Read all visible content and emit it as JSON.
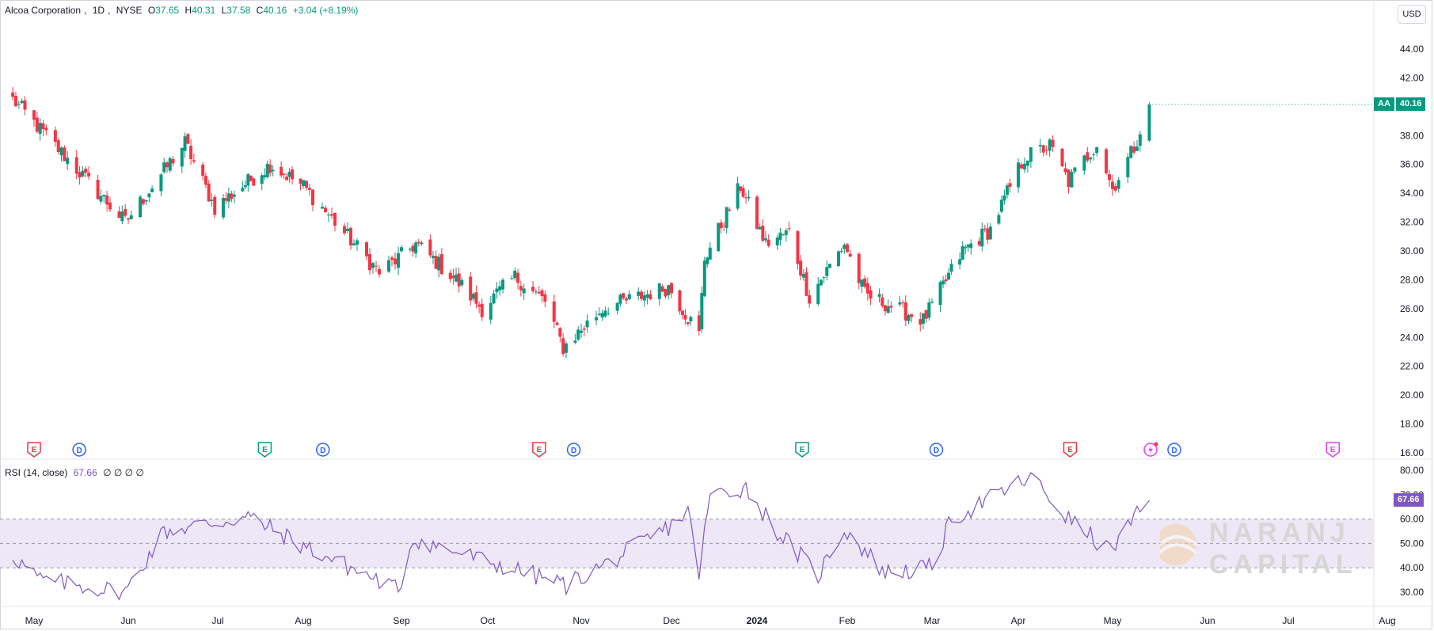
{
  "header": {
    "symbol_name": "Alcoa Corporation",
    "interval": "1D",
    "exchange": "NYSE",
    "open_label": "O",
    "open": "37.65",
    "high_label": "H",
    "high": "40.31",
    "low_label": "L",
    "low": "37.58",
    "close_label": "C",
    "close": "40.16",
    "change": "+3.04 (+8.19%)"
  },
  "currency": "USD",
  "last_price_tag": {
    "symbol": "AA",
    "value": "40.16"
  },
  "rsi": {
    "label": "RSI (14, close)",
    "value": "67.66",
    "extra": "∅ ∅ ∅ ∅"
  },
  "watermark": {
    "line1": "NARANJ",
    "line2": "CAPITAL"
  },
  "colors": {
    "up": "#089981",
    "down": "#f23645",
    "rsi": "#7e57c2",
    "rsi_band": "#ede7f6",
    "dividend": "#2962ff",
    "earnings_green": "#089981",
    "earnings_red": "#f23645",
    "earnings_purple": "#e040fb"
  },
  "chart_data": {
    "type": "candlestick",
    "price_axis": {
      "ticks": [
        "44.00",
        "42.00",
        "40.00",
        "38.00",
        "36.00",
        "34.00",
        "32.00",
        "30.00",
        "28.00",
        "26.00",
        "24.00",
        "22.00",
        "20.00",
        "18.00",
        "16.00"
      ],
      "ylim": [
        16,
        44
      ]
    },
    "time_axis": {
      "ticks": [
        "May",
        "Jun",
        "Jul",
        "Aug",
        "Sep",
        "Oct",
        "Nov",
        "Dec",
        "2024",
        "Feb",
        "Mar",
        "Apr",
        "May",
        "Jun",
        "Jul",
        "Aug"
      ]
    },
    "rsi_axis": {
      "ticks": [
        "80.00",
        "70.00",
        "60.00",
        "50.00",
        "40.00",
        "30.00"
      ],
      "band": [
        40,
        60
      ],
      "ylim": [
        25,
        82
      ]
    },
    "events": [
      {
        "type": "E",
        "style": "red",
        "month_pos": 0.0
      },
      {
        "type": "D",
        "style": "blue",
        "month_pos": 0.48
      },
      {
        "type": "E",
        "style": "green",
        "month_pos": 2.55
      },
      {
        "type": "D",
        "style": "blue",
        "month_pos": 3.2
      },
      {
        "type": "E",
        "style": "red",
        "month_pos": 5.55
      },
      {
        "type": "D",
        "style": "blue",
        "month_pos": 5.92
      },
      {
        "type": "E",
        "style": "green",
        "month_pos": 8.5
      },
      {
        "type": "D",
        "style": "blue",
        "month_pos": 10.05
      },
      {
        "type": "E",
        "style": "red",
        "month_pos": 11.55
      },
      {
        "type": "split",
        "style": "purple",
        "month_pos": 12.4
      },
      {
        "type": "D",
        "style": "blue",
        "month_pos": 12.65
      },
      {
        "type": "E",
        "style": "purple",
        "month_pos": 14.45
      }
    ],
    "key_points": [
      {
        "date": "2023-04-24",
        "close": 40.5
      },
      {
        "date": "2023-05-31",
        "close": 32.0
      },
      {
        "date": "2023-06-20",
        "close": 37.5
      },
      {
        "date": "2023-06-30",
        "close": 33.0
      },
      {
        "date": "2023-07-20",
        "close": 36.0
      },
      {
        "date": "2023-08-01",
        "close": 34.5
      },
      {
        "date": "2023-08-25",
        "close": 28.5
      },
      {
        "date": "2023-09-06",
        "close": 30.5
      },
      {
        "date": "2023-09-20",
        "close": 28.0
      },
      {
        "date": "2023-09-29",
        "close": 26.0
      },
      {
        "date": "2023-10-10",
        "close": 28.2
      },
      {
        "date": "2023-10-20",
        "close": 26.5
      },
      {
        "date": "2023-10-26",
        "close": 23.3
      },
      {
        "date": "2023-11-08",
        "close": 26.0
      },
      {
        "date": "2023-11-30",
        "close": 27.5
      },
      {
        "date": "2023-12-11",
        "close": 24.2
      },
      {
        "date": "2023-12-13",
        "close": 29.5
      },
      {
        "date": "2023-12-26",
        "close": 34.5
      },
      {
        "date": "2024-01-04",
        "close": 30.5
      },
      {
        "date": "2024-01-12",
        "close": 31.3
      },
      {
        "date": "2024-01-19",
        "close": 26.8
      },
      {
        "date": "2024-01-31",
        "close": 30.5
      },
      {
        "date": "2024-02-07",
        "close": 27.0
      },
      {
        "date": "2024-02-27",
        "close": 25.2
      },
      {
        "date": "2024-03-12",
        "close": 30.0
      },
      {
        "date": "2024-03-22",
        "close": 31.5
      },
      {
        "date": "2024-04-03",
        "close": 36.5
      },
      {
        "date": "2024-04-11",
        "close": 37.3
      },
      {
        "date": "2024-04-17",
        "close": 34.8
      },
      {
        "date": "2024-04-26",
        "close": 37.5
      },
      {
        "date": "2024-05-01",
        "close": 34.3
      },
      {
        "date": "2024-05-08",
        "close": 37.2
      },
      {
        "date": "2024-05-13",
        "close": 40.16
      }
    ],
    "rsi_key_points": [
      {
        "date": "2023-04-24",
        "rsi": 45
      },
      {
        "date": "2023-05-03",
        "rsi": 35
      },
      {
        "date": "2023-05-31",
        "rsi": 30
      },
      {
        "date": "2023-06-13",
        "rsi": 55
      },
      {
        "date": "2023-07-12",
        "rsi": 61
      },
      {
        "date": "2023-08-31",
        "rsi": 31
      },
      {
        "date": "2023-09-05",
        "rsi": 52
      },
      {
        "date": "2023-10-27",
        "rsi": 33
      },
      {
        "date": "2023-11-10",
        "rsi": 42
      },
      {
        "date": "2023-11-28",
        "rsi": 55
      },
      {
        "date": "2023-12-07",
        "rsi": 63
      },
      {
        "date": "2023-12-11",
        "rsi": 38
      },
      {
        "date": "2023-12-15",
        "rsi": 70
      },
      {
        "date": "2023-12-28",
        "rsi": 73
      },
      {
        "date": "2024-01-08",
        "rsi": 55
      },
      {
        "date": "2024-01-22",
        "rsi": 37
      },
      {
        "date": "2024-01-31",
        "rsi": 56
      },
      {
        "date": "2024-02-14",
        "rsi": 38
      },
      {
        "date": "2024-03-01",
        "rsi": 40
      },
      {
        "date": "2024-03-08",
        "rsi": 60
      },
      {
        "date": "2024-04-05",
        "rsi": 77
      },
      {
        "date": "2024-04-17",
        "rsi": 60
      },
      {
        "date": "2024-04-30",
        "rsi": 47
      },
      {
        "date": "2024-05-13",
        "rsi": 67.66
      }
    ]
  }
}
